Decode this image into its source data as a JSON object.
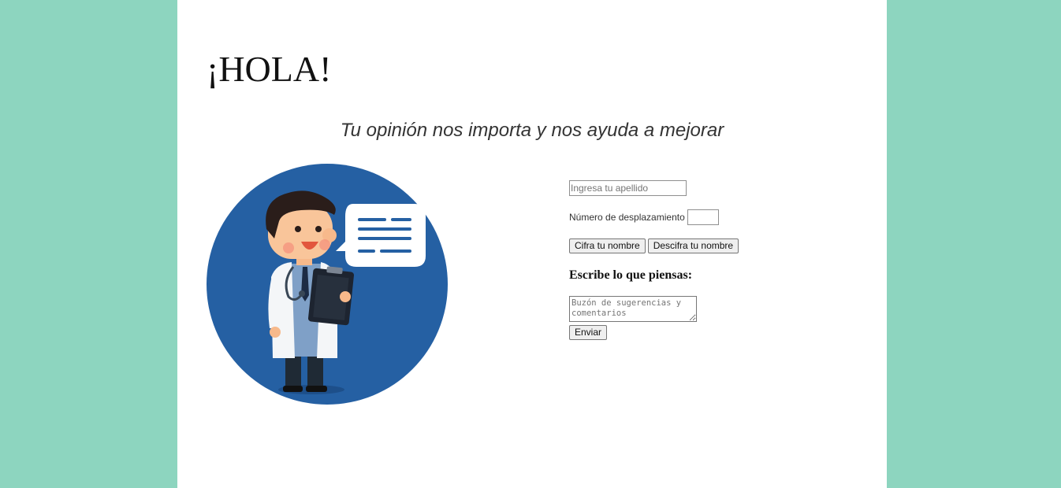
{
  "greeting": "¡HOLA!",
  "subtitle": "Tu opinión nos importa y nos ayuda a mejorar",
  "illustration": {
    "icon": "doctor-with-clipboard-and-speech-bubble-icon",
    "circle_color": "#2560a3"
  },
  "form": {
    "surname_placeholder": "Ingresa tu apellido",
    "surname_value": "",
    "shift_label": "Número de desplazamiento",
    "shift_value": "",
    "encrypt_button": "Cifra tu nombre",
    "decrypt_button": "Descifra tu nombre",
    "comments_heading": "Escribe lo que piensas:",
    "comments_placeholder": "Buzón de sugerencias y comentarios",
    "comments_value": "",
    "send_button": "Enviar"
  },
  "colors": {
    "background": "#8dd5bf",
    "page": "#ffffff"
  }
}
